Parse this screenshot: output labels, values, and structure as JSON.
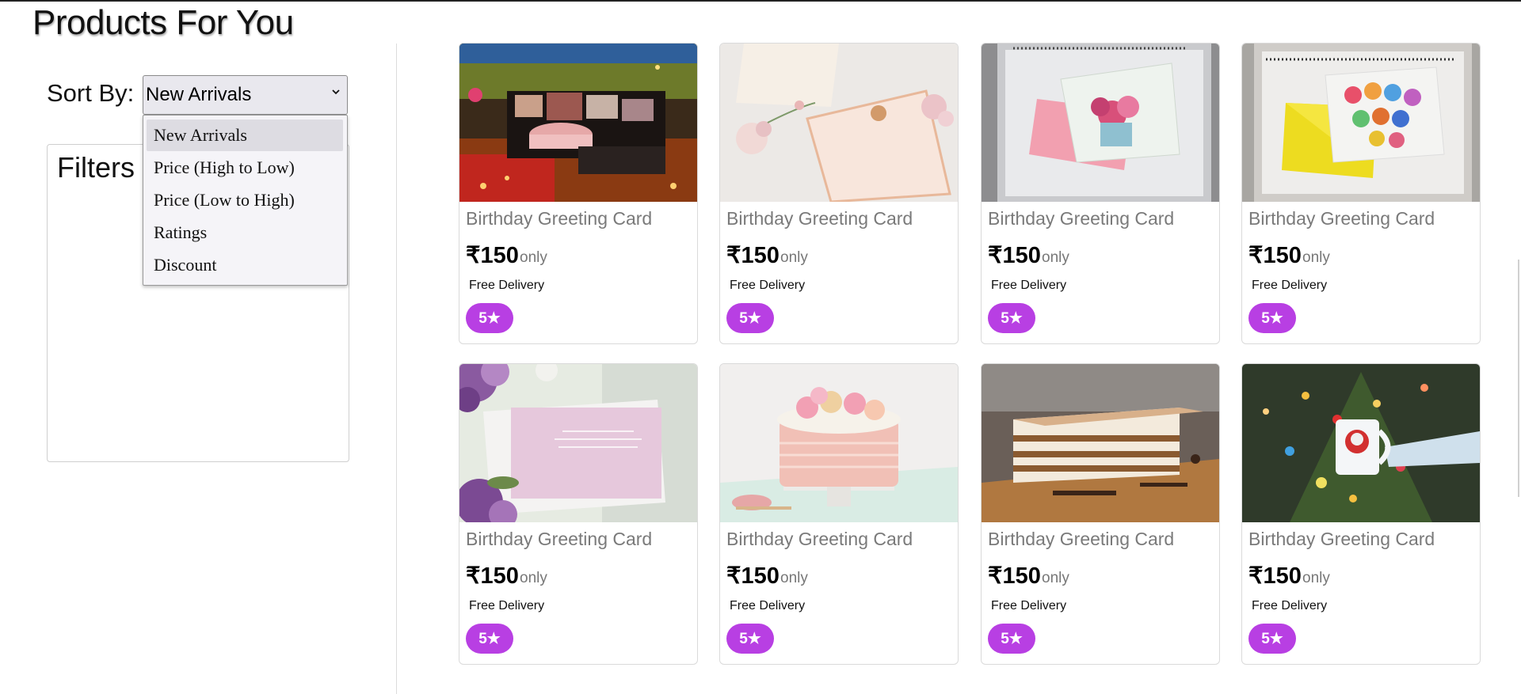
{
  "page": {
    "title": "Products For You"
  },
  "sort": {
    "label": "Sort By:",
    "selected": "New Arrivals",
    "options": [
      {
        "label": "New Arrivals",
        "selected": true
      },
      {
        "label": "Price (High to Low)",
        "selected": false
      },
      {
        "label": "Price (Low to High)",
        "selected": false
      },
      {
        "label": "Ratings",
        "selected": false
      },
      {
        "label": "Discount",
        "selected": false
      }
    ]
  },
  "filters": {
    "title": "Filters"
  },
  "colors": {
    "rating_badge": "#b83fe3",
    "accent_text": "#7a7a7a"
  },
  "products": [
    {
      "name": "Birthday Greeting Card",
      "price": "₹150",
      "price_suffix": "only",
      "delivery": "Free Delivery",
      "rating": "5★",
      "image": "gift-box-with-cake-and-lights"
    },
    {
      "name": "Birthday Greeting Card",
      "price": "₹150",
      "price_suffix": "only",
      "delivery": "Free Delivery",
      "rating": "5★",
      "image": "wedding-invitation-with-flowers"
    },
    {
      "name": "Birthday Greeting Card",
      "price": "₹150",
      "price_suffix": "only",
      "delivery": "Free Delivery",
      "rating": "5★",
      "image": "just-for-you-card-pink-envelope"
    },
    {
      "name": "Birthday Greeting Card",
      "price": "₹150",
      "price_suffix": "only",
      "delivery": "Free Delivery",
      "rating": "5★",
      "image": "happy-birthday-card-yellow-envelope"
    },
    {
      "name": "Birthday Greeting Card",
      "price": "₹150",
      "price_suffix": "only",
      "delivery": "Free Delivery",
      "rating": "5★",
      "image": "pink-card-purple-flowers"
    },
    {
      "name": "Birthday Greeting Card",
      "price": "₹150",
      "price_suffix": "only",
      "delivery": "Free Delivery",
      "rating": "5★",
      "image": "pink-macaron-cake"
    },
    {
      "name": "Birthday Greeting Card",
      "price": "₹150",
      "price_suffix": "only",
      "delivery": "Free Delivery",
      "rating": "5★",
      "image": "layered-chocolate-cake"
    },
    {
      "name": "Birthday Greeting Card",
      "price": "₹150",
      "price_suffix": "only",
      "delivery": "Free Delivery",
      "rating": "5★",
      "image": "christmas-mug-with-lights"
    }
  ]
}
